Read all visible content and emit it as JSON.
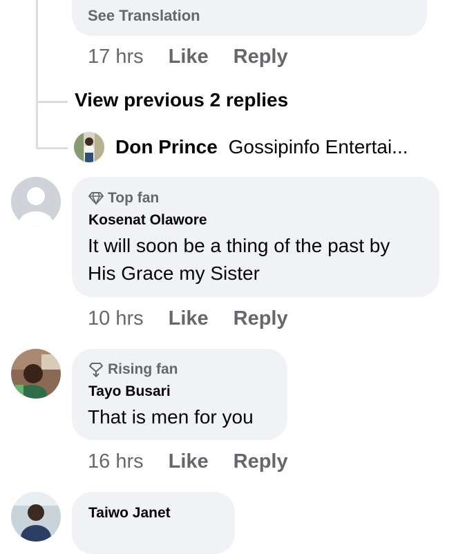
{
  "top_comment": {
    "see_translation": "See Translation",
    "time": "17 hrs",
    "like": "Like",
    "reply": "Reply"
  },
  "view_previous": "View previous 2 replies",
  "reply_preview": {
    "author": "Don Prince",
    "text": "Gossipinfo Entertai..."
  },
  "comments": [
    {
      "badge_icon": "diamond-icon",
      "badge": "Top fan",
      "author": "Kosenat Olawore",
      "text_line1": "It will soon be a thing of the past by",
      "text_line2": "His Grace my Sister",
      "time": "10 hrs",
      "like": "Like",
      "reply": "Reply"
    },
    {
      "badge_icon": "rising-fan-icon",
      "badge": "Rising fan",
      "author": "Tayo Busari",
      "text_line1": "That is men for you",
      "time": "16 hrs",
      "like": "Like",
      "reply": "Reply"
    },
    {
      "author": "Taiwo Janet"
    }
  ],
  "colors": {
    "bubble": "#f0f2f5",
    "secondary_text": "#65676b",
    "primary_text": "#050505",
    "thread_line": "#dadde1"
  }
}
